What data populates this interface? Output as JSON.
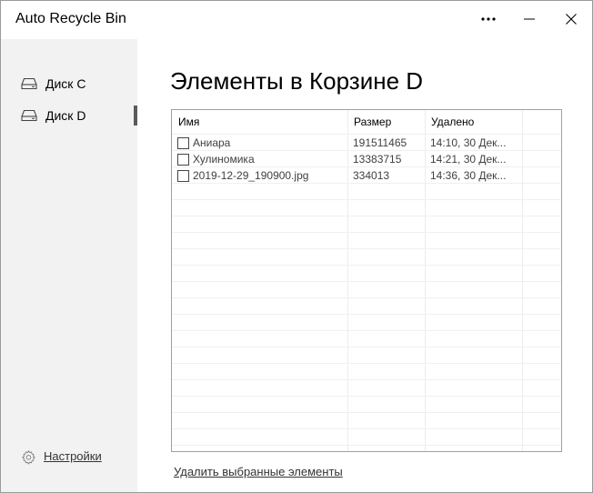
{
  "window": {
    "title": "Auto Recycle Bin"
  },
  "titlebar": {
    "more_icon": "more-horizontal-icon",
    "minimize_icon": "minimize-icon",
    "close_icon": "close-icon"
  },
  "sidebar": {
    "items": [
      {
        "label": "Диск C",
        "icon": "drive-icon",
        "selected": false
      },
      {
        "label": "Диск D",
        "icon": "drive-icon",
        "selected": true
      }
    ],
    "settings_label": "Настройки",
    "settings_icon": "gear-icon"
  },
  "main": {
    "heading": "Элементы в Корзине D",
    "columns": [
      "Имя",
      "Размер",
      "Удалено"
    ],
    "rows": [
      {
        "name": "Аниара",
        "size": "191511465",
        "deleted": "14:10, 30 Дек..."
      },
      {
        "name": "Хулиномика",
        "size": "13383715",
        "deleted": "14:21, 30 Дек..."
      },
      {
        "name": "2019-12-29_190900.jpg",
        "size": "334013",
        "deleted": "14:36, 30 Дек..."
      }
    ],
    "delete_label": "Удалить выбранные элементы"
  },
  "colors": {
    "sidebar_bg": "#f2f2f2",
    "selected_indicator": "#5a5a5a",
    "grid_line": "#ececec"
  }
}
